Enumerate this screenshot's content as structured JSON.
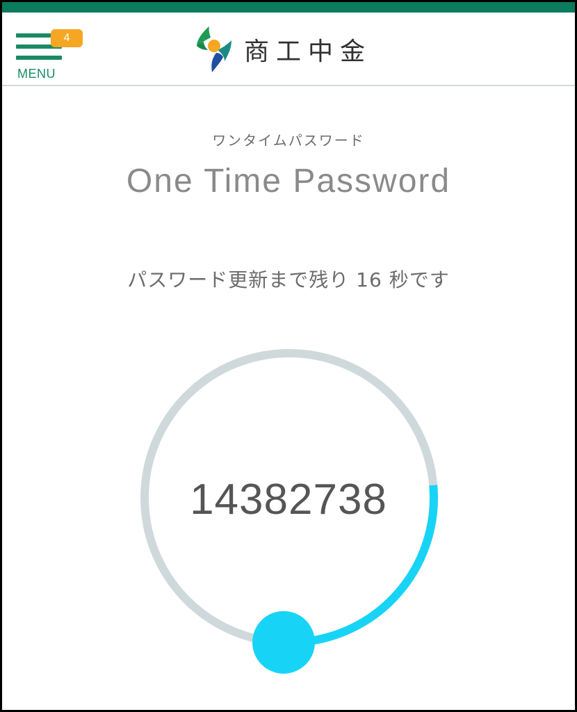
{
  "header": {
    "menu_label": "MENU",
    "menu_badge": "4",
    "logo_text": "商工中金",
    "logo_icon": "shokochukin-logo-icon",
    "menu_icon": "hamburger-menu-icon"
  },
  "main": {
    "subtitle_jp": "ワンタイムパスワード",
    "title_en": "One Time Password",
    "countdown_text": "パスワード更新まで残り 16 秒です",
    "otp_code": "14382738"
  },
  "timer": {
    "remaining_seconds": 16,
    "remaining_fraction": 0.27,
    "track_color": "#cfd9dc",
    "progress_color": "#17d4f7"
  },
  "colors": {
    "brand_green": "#0c7a5c",
    "menu_green": "#1a8a64",
    "badge_orange": "#f5a623"
  }
}
